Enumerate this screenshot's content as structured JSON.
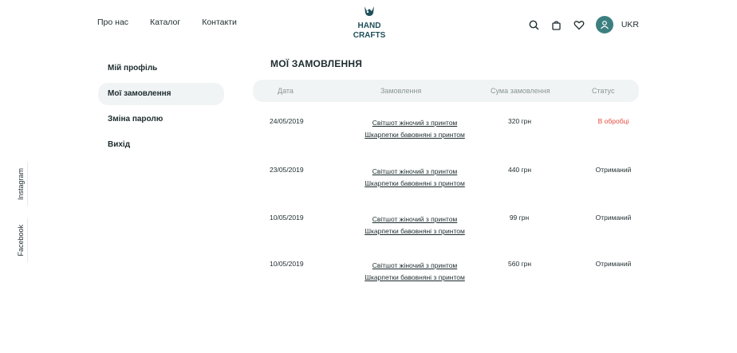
{
  "nav": {
    "about": "Про нас",
    "catalog": "Каталог",
    "contacts": "Контакти"
  },
  "logo": {
    "line1": "HAND",
    "line2": "CRAFTS"
  },
  "header": {
    "lang": "UKR",
    "icons": [
      "search-icon",
      "bag-icon",
      "heart-icon",
      "user-icon"
    ]
  },
  "sidebar": {
    "items": [
      {
        "label": "Мій профіль"
      },
      {
        "label": "Мої замовлення"
      },
      {
        "label": "Зміна паролю"
      },
      {
        "label": "Вихід"
      }
    ],
    "active_index": 1
  },
  "social": {
    "instagram": "Instagram",
    "facebook": "Facebook"
  },
  "orders": {
    "title": "МОЇ ЗАМОВЛЕННЯ",
    "columns": {
      "date": "Дата",
      "order": "Замовлення",
      "sum": "Сума замовлення",
      "status": "Статус"
    },
    "rows": [
      {
        "date": "24/05/2019",
        "item1": "Світшот жіночий з принтом",
        "item2": "Шкарпетки бавовняні з принтом",
        "sum": "320 грн",
        "status": "В обробці"
      },
      {
        "date": "23/05/2019",
        "item1": "Світшот жіночий з принтом",
        "item2": "Шкарпетки бавовняні з принтом",
        "sum": "440 грн",
        "status": "Отриманий"
      },
      {
        "date": "10/05/2019",
        "item1": "Світшот жіночий з принтом",
        "item2": "Шкарпетки бавовняні з принтом",
        "sum": "99 грн",
        "status": "Отриманий"
      },
      {
        "date": "10/05/2019",
        "item1": "Світшот жіночий з принтом",
        "item2": "Шкарпетки бавовняні з принтом",
        "sum": "560 грн",
        "status": "Отриманий"
      }
    ]
  },
  "colors": {
    "accent": "#3d7f80",
    "status_processing": "#e44b3c",
    "panel": "#f1f4f5"
  }
}
